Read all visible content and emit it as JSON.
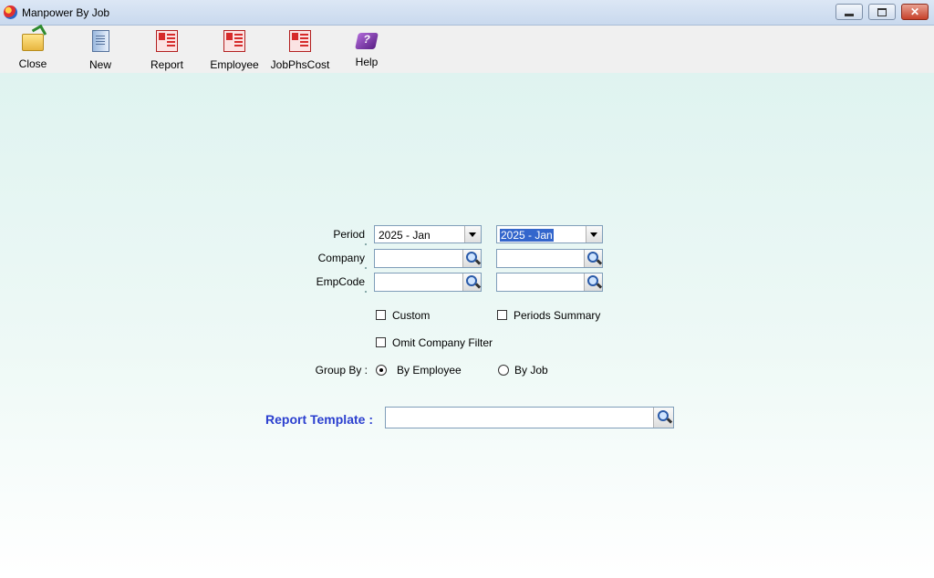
{
  "window": {
    "title": "Manpower By Job",
    "minimize_label": "",
    "maximize_label": "",
    "close_label": "✕"
  },
  "toolbar": {
    "items": [
      {
        "label": "Close",
        "icon": "open-folder-icon"
      },
      {
        "label": "New",
        "icon": "document-icon"
      },
      {
        "label": "Report",
        "icon": "report-icon"
      },
      {
        "label": "Employee",
        "icon": "report-icon"
      },
      {
        "label": "JobPhsCost",
        "icon": "report-icon"
      },
      {
        "label": "Help",
        "icon": "help-book-icon"
      }
    ]
  },
  "form": {
    "period": {
      "label": "Period",
      "from": "2025 - Jan",
      "to": "2025 - Jan"
    },
    "company": {
      "label": "Company",
      "from": "",
      "to": ""
    },
    "empcode": {
      "label": "EmpCode",
      "from": "",
      "to": ""
    },
    "custom": {
      "label": "Custom",
      "checked": false
    },
    "periods_summary": {
      "label": "Periods Summary",
      "checked": false
    },
    "omit_company_filter": {
      "label": "Omit Company Filter",
      "checked": false
    },
    "group_by": {
      "label": "Group By :",
      "options": [
        {
          "label": "By Employee",
          "selected": true
        },
        {
          "label": "By Job",
          "selected": false
        }
      ]
    },
    "report_template": {
      "label": "Report Template :",
      "value": ""
    }
  },
  "colors": {
    "report_template_label": "#2b3fcf",
    "selection": "#3366cc"
  }
}
